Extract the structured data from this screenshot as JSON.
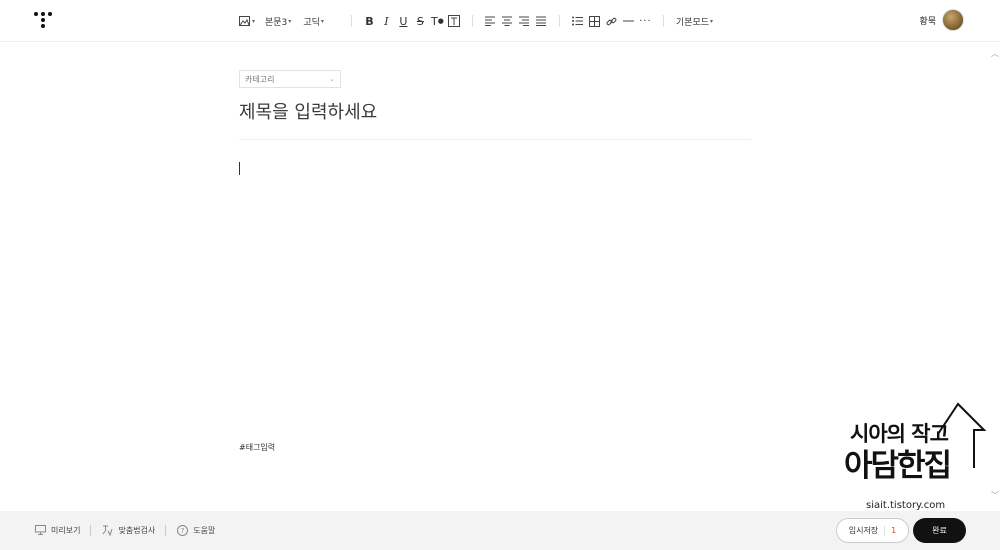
{
  "toolbar": {
    "paragraph_style": "본문3",
    "font_family": "고딕",
    "mode": "기본모드",
    "icons": [
      "image-icon",
      "bold-icon",
      "italic-icon",
      "underline-icon",
      "strikethrough-icon",
      "text-color-icon",
      "text-background-icon",
      "align-left-icon",
      "align-center-icon",
      "align-right-icon",
      "align-justify-icon",
      "bullet-list-icon",
      "table-icon",
      "link-icon",
      "horizontal-rule-icon",
      "more-icon"
    ]
  },
  "user": {
    "name": "황묵"
  },
  "editor": {
    "category_placeholder": "카테고리",
    "title_placeholder": "제목을 입력하세요",
    "tag_placeholder": "#태그입력"
  },
  "watermark": {
    "line1": "시아의 작고",
    "line2": "아담한집",
    "url": "siait.tistory.com"
  },
  "bottombar": {
    "preview": "미리보기",
    "spellcheck": "맞춤법검사",
    "help": "도움말",
    "temp_save": "임시저장",
    "temp_save_count": "1",
    "done": "완료"
  },
  "colors": {
    "accent_count": "#e5432a",
    "done_button": "#111111"
  }
}
